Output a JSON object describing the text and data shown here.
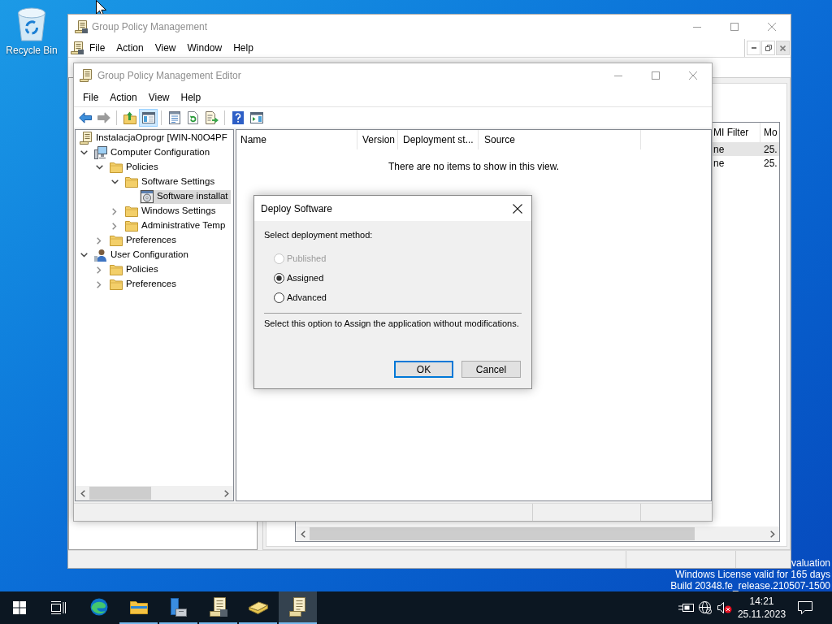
{
  "desktop": {
    "icons": [
      {
        "kind": "recycle_bin",
        "label": "Recycle Bin"
      }
    ],
    "system_text": [
      "valuation",
      "Windows License valid for 165 days",
      "Build 20348.fe_release.210507-1500"
    ]
  },
  "background_window": {
    "title": "Group Policy Management",
    "menu": [
      "File",
      "Action",
      "View",
      "Window",
      "Help"
    ],
    "table": {
      "columns": [
        "MI Filter",
        "Mo"
      ],
      "rows": [
        {
          "cells": [
            "ne",
            "25."
          ],
          "selected": true
        },
        {
          "cells": [
            "ne",
            "25."
          ],
          "selected": false
        }
      ]
    }
  },
  "editor_window": {
    "title": "Group Policy Management Editor",
    "menu": [
      "File",
      "Action",
      "View",
      "Help"
    ],
    "toolbar": [
      [
        {
          "kind": "back",
          "disabled": false,
          "selected": false
        },
        {
          "kind": "forward",
          "disabled": true,
          "selected": false
        }
      ],
      [
        {
          "kind": "up",
          "disabled": false,
          "selected": false
        },
        {
          "kind": "tree",
          "disabled": false,
          "selected": true
        }
      ],
      [
        {
          "kind": "properties",
          "disabled": false,
          "selected": false
        },
        {
          "kind": "refresh",
          "disabled": false,
          "selected": false
        },
        {
          "kind": "export",
          "disabled": false,
          "selected": false
        }
      ],
      [
        {
          "kind": "help",
          "disabled": false,
          "selected": false
        },
        {
          "kind": "action_pane",
          "disabled": false,
          "selected": false
        }
      ]
    ],
    "tree": [
      {
        "label": "InstalacjaOprogr [WIN-N0O4PF",
        "kind": "policy",
        "selected": false,
        "children": [
          {
            "label": "Computer Configuration",
            "kind": "computer",
            "expanded": true,
            "selected": false,
            "children": [
              {
                "label": "Policies",
                "kind": "folder",
                "expanded": true,
                "selected": false,
                "children": [
                  {
                    "label": "Software Settings",
                    "kind": "folder",
                    "expanded": true,
                    "selected": false,
                    "children": [
                      {
                        "label": "Software installat",
                        "kind": "package",
                        "selected": true
                      }
                    ]
                  },
                  {
                    "label": "Windows Settings",
                    "kind": "folder",
                    "expanded": false,
                    "selected": false
                  },
                  {
                    "label": "Administrative Temp",
                    "kind": "folder",
                    "expanded": false,
                    "selected": false
                  }
                ]
              },
              {
                "label": "Preferences",
                "kind": "folder",
                "expanded": false,
                "selected": false
              }
            ]
          },
          {
            "label": "User Configuration",
            "kind": "user",
            "expanded": true,
            "selected": false,
            "children": [
              {
                "label": "Policies",
                "kind": "folder",
                "expanded": false,
                "selected": false
              },
              {
                "label": "Preferences",
                "kind": "folder",
                "expanded": false,
                "selected": false
              }
            ]
          }
        ]
      }
    ],
    "list": {
      "columns": [
        "Name",
        "Version",
        "Deployment st...",
        "Source"
      ],
      "empty_message": "There are no items to show in this view."
    }
  },
  "dialog": {
    "title": "Deploy Software",
    "prompt": "Select deployment method:",
    "options": [
      {
        "label": "Published",
        "selected": false,
        "disabled": true
      },
      {
        "label": "Assigned",
        "selected": true,
        "disabled": false
      },
      {
        "label": "Advanced",
        "selected": false,
        "disabled": false
      }
    ],
    "description": "Select this option to Assign the application without modifications.",
    "buttons": [
      {
        "label": "OK",
        "default": true
      },
      {
        "label": "Cancel",
        "default": false
      }
    ]
  },
  "taskbar": {
    "apps": [
      {
        "kind": "browser",
        "running": false,
        "active": false
      },
      {
        "kind": "explorer",
        "running": true,
        "active": false
      },
      {
        "kind": "server_manager",
        "running": true,
        "active": false
      },
      {
        "kind": "policy_manager",
        "running": true,
        "active": false
      },
      {
        "kind": "book",
        "running": true,
        "active": false
      },
      {
        "kind": "policy_editor",
        "running": true,
        "active": true
      }
    ],
    "clock": {
      "time": "14:21",
      "date": "25.11.2023"
    }
  }
}
